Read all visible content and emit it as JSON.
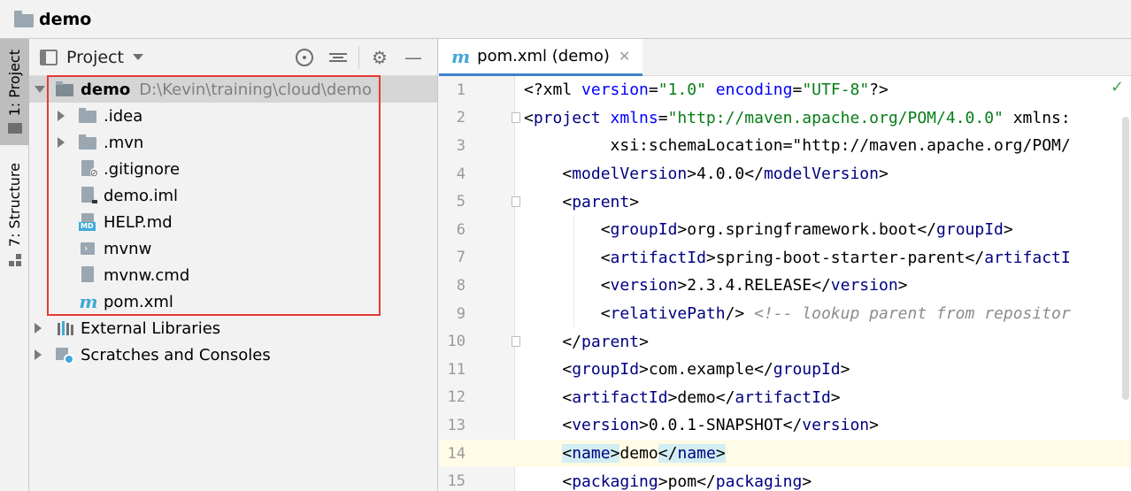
{
  "navbar": {
    "title": "demo"
  },
  "stripe": {
    "project_label": "1: Project",
    "structure_label": "7: Structure"
  },
  "panel": {
    "title": "Project",
    "tree": [
      {
        "label": "demo",
        "path": "D:\\Kevin\\training\\cloud\\demo",
        "icon": "module-folder-icon",
        "expanded": true,
        "bold": true
      },
      {
        "label": ".idea",
        "icon": "folder-icon",
        "expandable": true
      },
      {
        "label": ".mvn",
        "icon": "folder-icon",
        "expandable": true
      },
      {
        "label": ".gitignore",
        "icon": "ignored-file-icon"
      },
      {
        "label": "demo.iml",
        "icon": "iml-file-icon"
      },
      {
        "label": "HELP.md",
        "icon": "markdown-file-icon",
        "badge": "MD"
      },
      {
        "label": "mvnw",
        "icon": "script-file-icon"
      },
      {
        "label": "mvnw.cmd",
        "icon": "text-file-icon"
      },
      {
        "label": "pom.xml",
        "icon": "maven-icon",
        "glyph": "m"
      },
      {
        "label": "External Libraries",
        "icon": "libraries-icon",
        "expandable": true
      },
      {
        "label": "Scratches and Consoles",
        "icon": "scratches-icon",
        "expandable": true
      }
    ]
  },
  "editor": {
    "tab": {
      "label": "pom.xml (demo)",
      "glyph": "m"
    },
    "lines": [
      {
        "n": "1",
        "text": "<?xml version=\"1.0\" encoding=\"UTF-8\"?>"
      },
      {
        "n": "2",
        "text": "<project xmlns=\"http://maven.apache.org/POM/4.0.0\" xmlns:"
      },
      {
        "n": "3",
        "text": "         xsi:schemaLocation=\"http://maven.apache.org/POM/"
      },
      {
        "n": "4",
        "text": "    <modelVersion>4.0.0</modelVersion>"
      },
      {
        "n": "5",
        "text": "    <parent>"
      },
      {
        "n": "6",
        "text": "        <groupId>org.springframework.boot</groupId>"
      },
      {
        "n": "7",
        "text": "        <artifactId>spring-boot-starter-parent</artifactI"
      },
      {
        "n": "8",
        "text": "        <version>2.3.4.RELEASE</version>"
      },
      {
        "n": "9",
        "text": "        <relativePath/> <!-- lookup parent from repositor"
      },
      {
        "n": "10",
        "text": "    </parent>"
      },
      {
        "n": "11",
        "text": "    <groupId>com.example</groupId>"
      },
      {
        "n": "12",
        "text": "    <artifactId>demo</artifactId>"
      },
      {
        "n": "13",
        "text": "    <version>0.0.1-SNAPSHOT</version>"
      },
      {
        "n": "14",
        "text": "    <name>demo</name>"
      },
      {
        "n": "15",
        "text": "    <packaging>pom</packaging>"
      }
    ],
    "current_line": "14"
  }
}
